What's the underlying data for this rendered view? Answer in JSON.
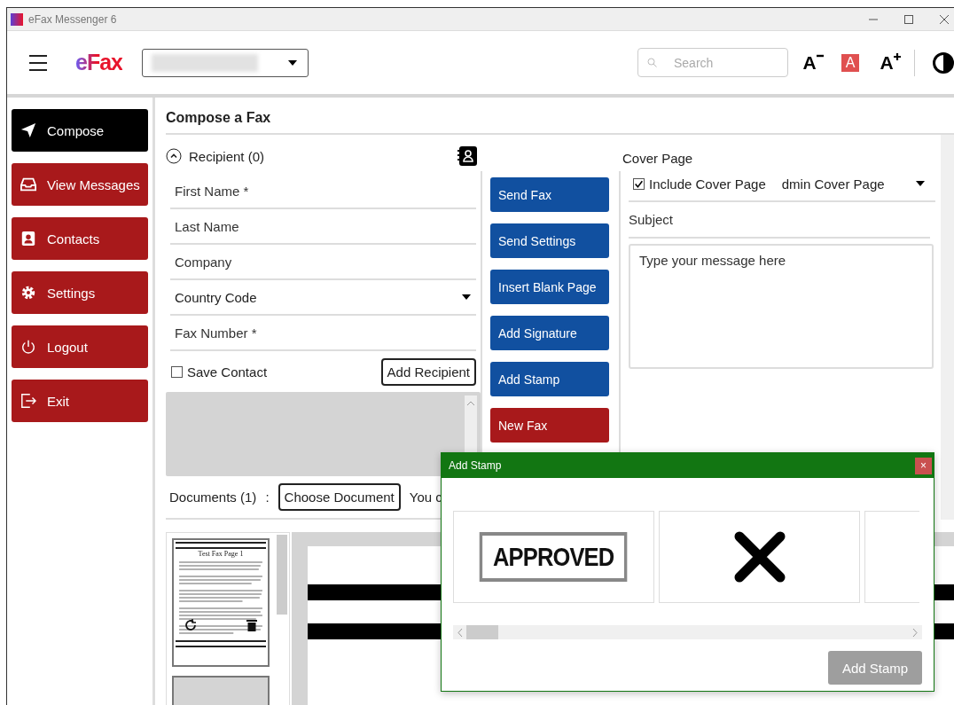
{
  "window": {
    "title": "eFax Messenger 6"
  },
  "header": {
    "logo": "eFax",
    "search": {
      "placeholder": "Search"
    },
    "font_tools": [
      {
        "kind": "smaller",
        "label": "A"
      },
      {
        "kind": "reset",
        "label": "A"
      },
      {
        "kind": "larger",
        "label": "A"
      }
    ]
  },
  "sidebar": {
    "items": [
      {
        "label": "Compose",
        "selected": true
      },
      {
        "label": "View Messages",
        "selected": false
      },
      {
        "label": "Contacts",
        "selected": false
      },
      {
        "label": "Settings",
        "selected": false
      },
      {
        "label": "Logout",
        "selected": false
      },
      {
        "label": "Exit",
        "selected": false
      }
    ]
  },
  "page_title": "Compose a Fax",
  "recipient": {
    "heading": "Recipient (0)",
    "expanded": true,
    "fields": [
      {
        "placeholder": "First Name *",
        "kind": "text"
      },
      {
        "placeholder": "Last Name",
        "kind": "text"
      },
      {
        "placeholder": "Company",
        "kind": "text"
      },
      {
        "placeholder": "Country Code",
        "kind": "select"
      },
      {
        "placeholder": "Fax Number *",
        "kind": "text"
      }
    ],
    "save_contact": {
      "label": "Save Contact",
      "checked": false
    },
    "add_button": "Add Recipient"
  },
  "actions": [
    {
      "label": "Send Fax",
      "kind": "primary"
    },
    {
      "label": "Send Settings",
      "kind": "primary"
    },
    {
      "label": "Insert Blank Page",
      "kind": "primary"
    },
    {
      "label": "Add Signature",
      "kind": "primary"
    },
    {
      "label": "Add Stamp",
      "kind": "primary"
    },
    {
      "label": "New Fax",
      "kind": "danger"
    }
  ],
  "cover_page": {
    "heading": "Cover Page",
    "include": {
      "label": "Include Cover Page",
      "checked": true
    },
    "template": "dmin Cover Page",
    "subject": {
      "placeholder": "Subject"
    },
    "message": {
      "placeholder": "Type your message here"
    }
  },
  "documents": {
    "label": "Documents (1)",
    "separator": ":",
    "choose_button": "Choose Document",
    "note": "You c",
    "thumbnail_title": "Test Fax Page 1"
  },
  "dialog": {
    "title": "Add Stamp",
    "close": "×",
    "stamps": [
      {
        "kind": "text",
        "label": "APPROVED"
      },
      {
        "kind": "cross"
      },
      {
        "kind": "blank"
      }
    ],
    "button": {
      "label": "Add Stamp",
      "disabled": true
    }
  }
}
